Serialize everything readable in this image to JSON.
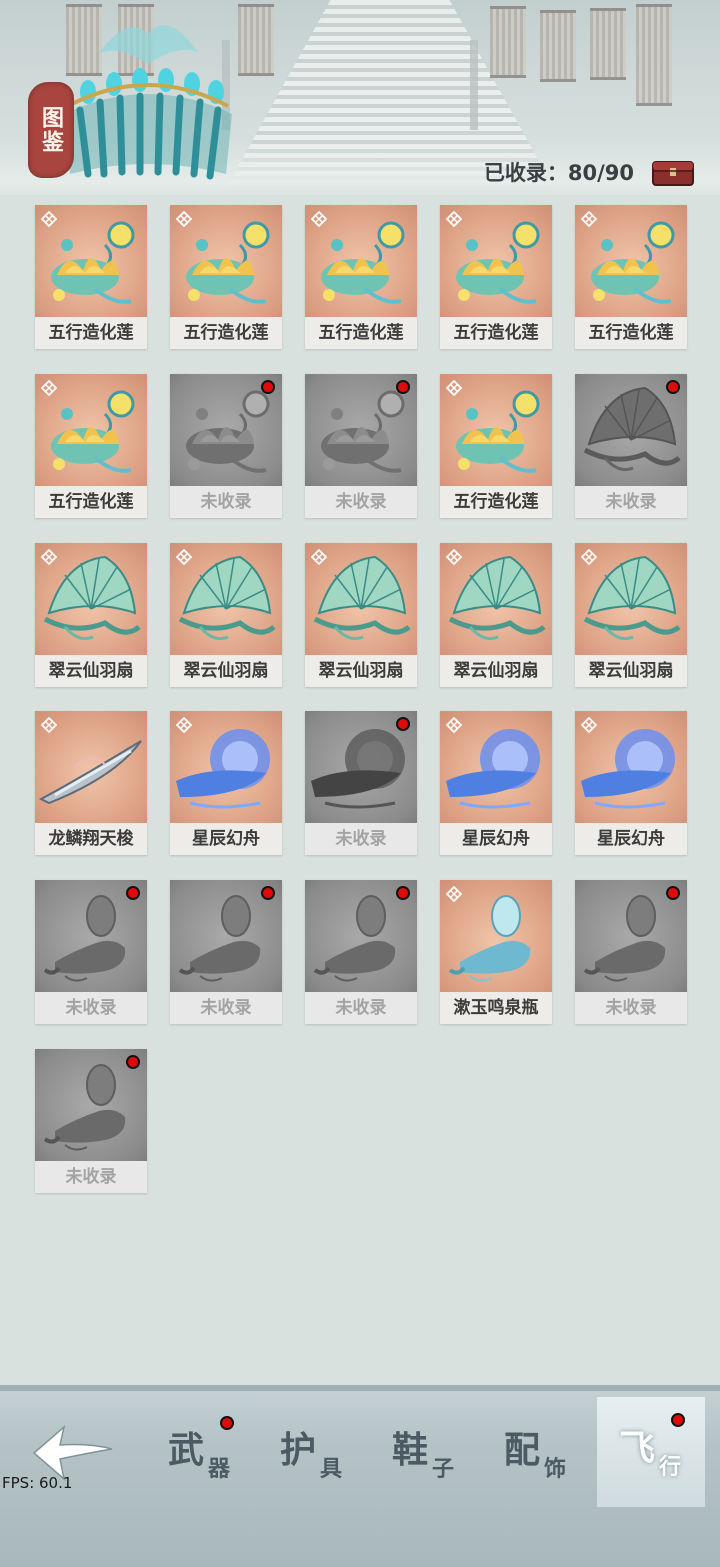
{
  "header": {
    "badge_label": "图鉴",
    "collected_text": "已收录：80/90"
  },
  "grid": {
    "items": [
      {
        "name": "五行造化莲",
        "collected": true,
        "art": "lotus-icon",
        "red_dot": false
      },
      {
        "name": "五行造化莲",
        "collected": true,
        "art": "lotus-icon",
        "red_dot": false
      },
      {
        "name": "五行造化莲",
        "collected": true,
        "art": "lotus-icon",
        "red_dot": false
      },
      {
        "name": "五行造化莲",
        "collected": true,
        "art": "lotus-icon",
        "red_dot": false
      },
      {
        "name": "五行造化莲",
        "collected": true,
        "art": "lotus-icon",
        "red_dot": false
      },
      {
        "name": "五行造化莲",
        "collected": true,
        "art": "lotus-icon",
        "red_dot": false
      },
      {
        "name": "未收录",
        "collected": false,
        "art": "lotus-icon",
        "red_dot": true
      },
      {
        "name": "未收录",
        "collected": false,
        "art": "lotus-icon",
        "red_dot": true
      },
      {
        "name": "五行造化莲",
        "collected": true,
        "art": "lotus-icon",
        "red_dot": false
      },
      {
        "name": "未收录",
        "collected": false,
        "art": "fan-icon",
        "red_dot": true
      },
      {
        "name": "翠云仙羽扇",
        "collected": true,
        "art": "fan-icon",
        "red_dot": false
      },
      {
        "name": "翠云仙羽扇",
        "collected": true,
        "art": "fan-icon",
        "red_dot": false
      },
      {
        "name": "翠云仙羽扇",
        "collected": true,
        "art": "fan-icon",
        "red_dot": false
      },
      {
        "name": "翠云仙羽扇",
        "collected": true,
        "art": "fan-icon",
        "red_dot": false
      },
      {
        "name": "翠云仙羽扇",
        "collected": true,
        "art": "fan-icon",
        "red_dot": false
      },
      {
        "name": "龙鳞翔天梭",
        "collected": true,
        "art": "shuttle-icon",
        "red_dot": false
      },
      {
        "name": "星辰幻舟",
        "collected": true,
        "art": "boat-icon",
        "red_dot": false
      },
      {
        "name": "未收录",
        "collected": false,
        "art": "boat-icon",
        "red_dot": true
      },
      {
        "name": "星辰幻舟",
        "collected": true,
        "art": "boat-icon",
        "red_dot": false
      },
      {
        "name": "星辰幻舟",
        "collected": true,
        "art": "boat-icon",
        "red_dot": false
      },
      {
        "name": "未收录",
        "collected": false,
        "art": "vase-icon",
        "red_dot": true
      },
      {
        "name": "未收录",
        "collected": false,
        "art": "vase-icon",
        "red_dot": true
      },
      {
        "name": "未收录",
        "collected": false,
        "art": "vase-icon",
        "red_dot": true
      },
      {
        "name": "漱玉鸣泉瓶",
        "collected": true,
        "art": "vase-icon",
        "red_dot": false
      },
      {
        "name": "未收录",
        "collected": false,
        "art": "vase-icon",
        "red_dot": true
      },
      {
        "name": "未收录",
        "collected": false,
        "art": "vase-icon",
        "red_dot": true
      }
    ]
  },
  "tabs": [
    {
      "big": "武",
      "small": "器",
      "red_dot": true,
      "active": false
    },
    {
      "big": "护",
      "small": "具",
      "red_dot": false,
      "active": false
    },
    {
      "big": "鞋",
      "small": "子",
      "red_dot": false,
      "active": false
    },
    {
      "big": "配",
      "small": "饰",
      "red_dot": false,
      "active": false
    },
    {
      "big": "飞",
      "small": "行",
      "red_dot": true,
      "active": true
    }
  ],
  "debug": {
    "fps_text": "FPS: 60.1"
  },
  "colors": {
    "collected_card_bg": "#dca084",
    "locked_card_bg": "#8b8b8b",
    "badge_red": "#a7453e",
    "red_dot": "#e00a0a"
  }
}
